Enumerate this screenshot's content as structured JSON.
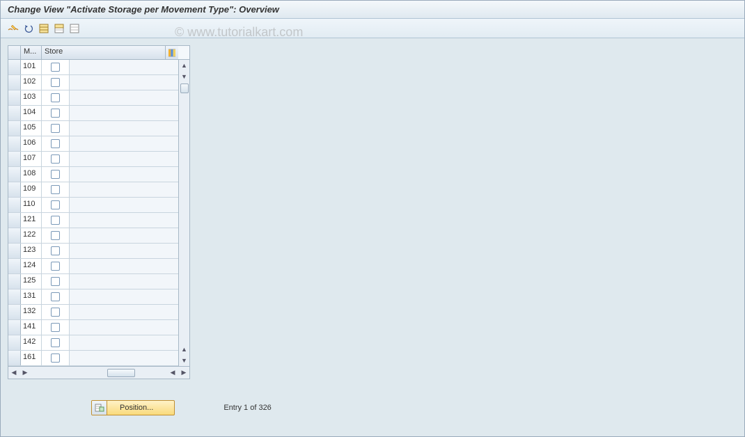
{
  "title": "Change View \"Activate Storage per Movement Type\": Overview",
  "watermark": "© www.tutorialkart.com",
  "toolbar": {
    "icons": [
      "glasses-pencil-icon",
      "undo-icon",
      "select-all-icon",
      "select-block-icon",
      "deselect-all-icon"
    ]
  },
  "table": {
    "columns": {
      "m": "M...",
      "store": "Store"
    },
    "rows": [
      {
        "m": "101",
        "store": false
      },
      {
        "m": "102",
        "store": false
      },
      {
        "m": "103",
        "store": false
      },
      {
        "m": "104",
        "store": false
      },
      {
        "m": "105",
        "store": false
      },
      {
        "m": "106",
        "store": false
      },
      {
        "m": "107",
        "store": false
      },
      {
        "m": "108",
        "store": false
      },
      {
        "m": "109",
        "store": false
      },
      {
        "m": "110",
        "store": false
      },
      {
        "m": "121",
        "store": false
      },
      {
        "m": "122",
        "store": false
      },
      {
        "m": "123",
        "store": false
      },
      {
        "m": "124",
        "store": false
      },
      {
        "m": "125",
        "store": false
      },
      {
        "m": "131",
        "store": false
      },
      {
        "m": "132",
        "store": false
      },
      {
        "m": "141",
        "store": false
      },
      {
        "m": "142",
        "store": false
      },
      {
        "m": "161",
        "store": false
      }
    ]
  },
  "footer": {
    "position_label": "Position...",
    "entry_text": "Entry 1 of 326"
  }
}
